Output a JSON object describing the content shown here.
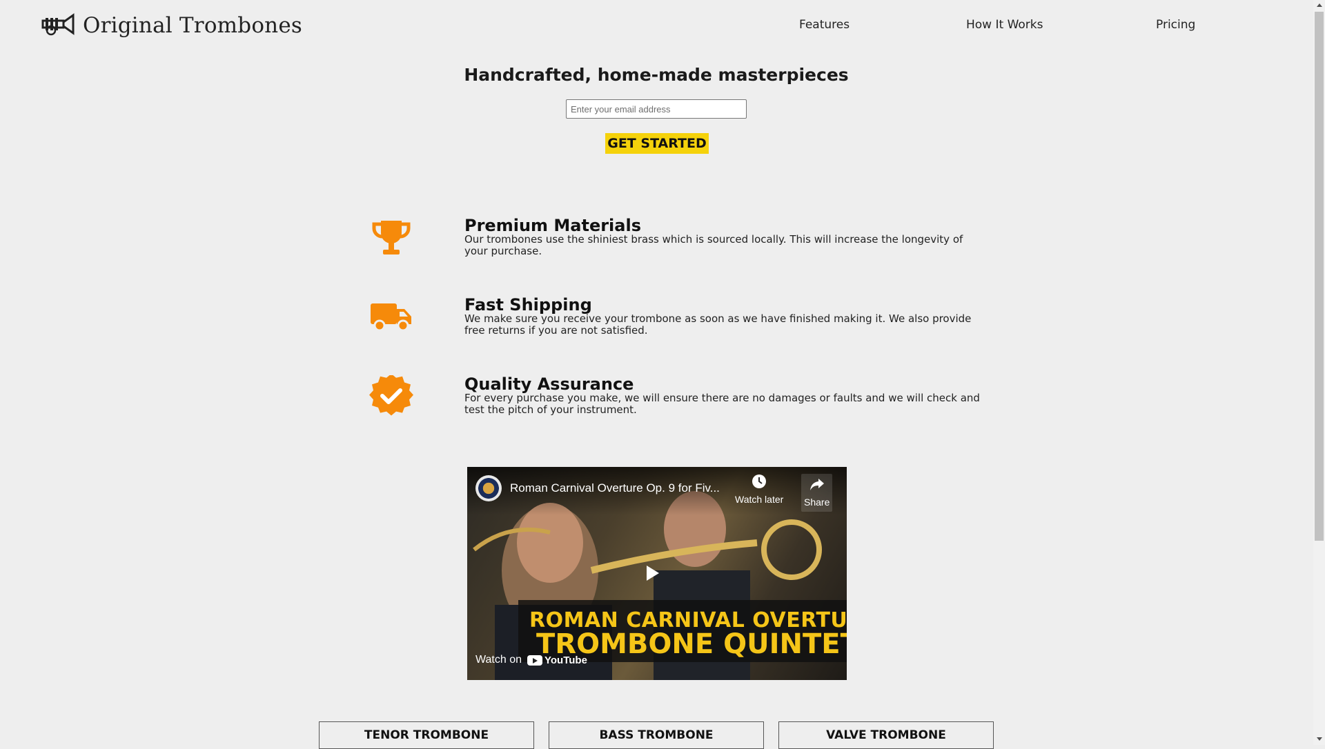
{
  "header": {
    "logo_text": "Original Trombones",
    "logo_icon": "trumpet-icon",
    "nav": [
      {
        "label": "Features"
      },
      {
        "label": "How It Works"
      },
      {
        "label": "Pricing"
      }
    ]
  },
  "hero": {
    "title": "Handcrafted, home-made masterpieces",
    "email_placeholder": "Enter your email address",
    "cta_label": "GET STARTED"
  },
  "features": [
    {
      "icon": "trophy-icon",
      "title": "Premium Materials",
      "description": "Our trombones use the shiniest brass which is sourced locally. This will increase the longevity of your purchase."
    },
    {
      "icon": "truck-icon",
      "title": "Fast Shipping",
      "description": "We make sure you receive your trombone as soon as we have finished making it. We also provide free returns if you are not satisfied."
    },
    {
      "icon": "verified-badge-icon",
      "title": "Quality Assurance",
      "description": "For every purchase you make, we will ensure there are no damages or faults and we will check and test the pitch of your instrument."
    }
  ],
  "video": {
    "title": "Roman Carnival Overture Op. 9 for Fiv...",
    "watch_later": "Watch later",
    "share": "Share",
    "banner_line1": "ROMAN CARNIVAL OVERTURE",
    "banner_line2": "TROMBONE QUINTET",
    "watch_on": "Watch on",
    "youtube": "YouTube"
  },
  "products": [
    {
      "label": "TENOR TROMBONE"
    },
    {
      "label": "BASS TROMBONE"
    },
    {
      "label": "VALVE TROMBONE"
    }
  ],
  "colors": {
    "accent_orange": "#f68a0a",
    "cta_yellow": "#f5d20b",
    "page_background": "#eeeeee"
  }
}
